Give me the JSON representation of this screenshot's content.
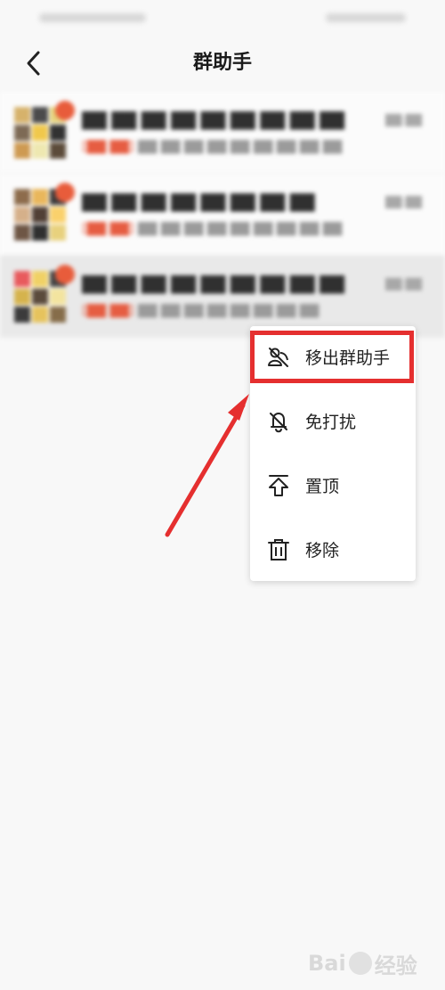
{
  "header": {
    "title": "群助手"
  },
  "menu": {
    "items": [
      {
        "label": "移出群助手",
        "icon": "group-remove-icon"
      },
      {
        "label": "免打扰",
        "icon": "bell-off-icon"
      },
      {
        "label": "置顶",
        "icon": "pin-top-icon"
      },
      {
        "label": "移除",
        "icon": "trash-icon"
      }
    ]
  },
  "colors": {
    "highlight_red": "#e52f2f",
    "badge_orange": "#e85c3b"
  },
  "watermark": {
    "brand": "Bai",
    "suffix": "经验"
  }
}
